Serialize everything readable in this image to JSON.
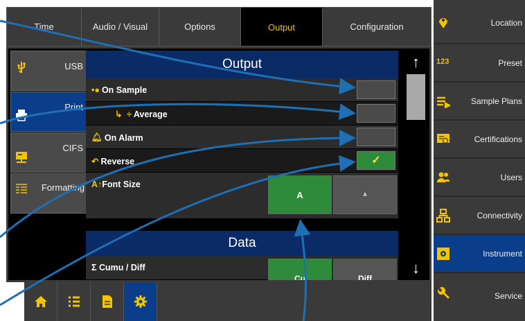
{
  "tabs": [
    {
      "label": "Time",
      "width": 108,
      "active": false
    },
    {
      "label": "Audio / Visual",
      "width": 112,
      "active": false
    },
    {
      "label": "Options",
      "width": 118,
      "active": false
    },
    {
      "label": "Output",
      "width": 118,
      "active": true
    },
    {
      "label": "Configuration",
      "width": 148,
      "active": false
    }
  ],
  "subnav": [
    {
      "label": "USB",
      "icon": "usb-icon",
      "active": false
    },
    {
      "label": "Print",
      "icon": "printer-icon",
      "active": true
    },
    {
      "label": "CIFS",
      "icon": "network-drive-icon",
      "active": false
    },
    {
      "label": "Formatting",
      "icon": "list-format-icon",
      "active": false
    }
  ],
  "output": {
    "title": "Output",
    "on_sample": {
      "label": "On Sample",
      "checked": false
    },
    "average": {
      "label": "Average",
      "checked": false
    },
    "on_alarm": {
      "label": "On Alarm",
      "checked": false
    },
    "reverse": {
      "label": "Reverse",
      "checked": true,
      "check_mark": "✓"
    },
    "font_size": {
      "label": "Font Size",
      "large": "A",
      "small": "A",
      "selected": "large"
    }
  },
  "data_section": {
    "title": "Data",
    "cumu_diff": {
      "label": "Cumu / Diff",
      "cumu": "Cu",
      "diff": "Diff",
      "selected": "cumu"
    }
  },
  "scroll": {
    "up": "↑",
    "down": "↓"
  },
  "right_sidebar": [
    {
      "label": "Location",
      "icon": "location-pin-icon",
      "active": false
    },
    {
      "label": "Preset",
      "icon": "preset-123-icon",
      "active": false,
      "icon_text": "123"
    },
    {
      "label": "Sample Plans",
      "icon": "sample-plans-icon",
      "active": false
    },
    {
      "label": "Certifications",
      "icon": "certificate-icon",
      "active": false
    },
    {
      "label": "Users",
      "icon": "users-icon",
      "active": false
    },
    {
      "label": "Connectivity",
      "icon": "network-icon",
      "active": false
    },
    {
      "label": "Instrument",
      "icon": "instrument-icon",
      "active": true
    },
    {
      "label": "Service",
      "icon": "wrench-icon",
      "active": false
    }
  ],
  "bottom_toolbar": [
    {
      "icon": "home-icon",
      "active": false
    },
    {
      "icon": "list-icon",
      "active": false
    },
    {
      "icon": "document-icon",
      "active": false
    },
    {
      "icon": "settings-gear-icon",
      "active": true
    }
  ],
  "colors": {
    "accent": "#f5c400",
    "active_blue": "#0a3d8a",
    "header_blue": "#0a2b66",
    "green": "#2e8b3a",
    "arrow": "#1f6fb5"
  }
}
